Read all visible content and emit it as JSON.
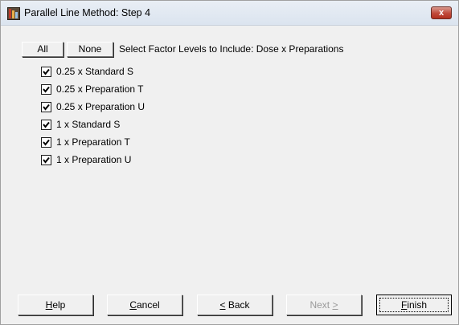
{
  "window": {
    "title": "Parallel Line Method: Step 4",
    "close_label": "x"
  },
  "toolbar": {
    "all_label": "All",
    "none_label": "None",
    "select_label": "Select Factor Levels to Include: Dose x Preparations"
  },
  "levels": [
    {
      "label": "0.25 x Standard S",
      "checked": true
    },
    {
      "label": "0.25 x Preparation T",
      "checked": true
    },
    {
      "label": "0.25 x Preparation U",
      "checked": true
    },
    {
      "label": "1 x Standard S",
      "checked": true
    },
    {
      "label": "1 x Preparation T",
      "checked": true
    },
    {
      "label": "1 x Preparation U",
      "checked": true
    }
  ],
  "buttons": {
    "help": {
      "hotkey": "H",
      "rest": "elp"
    },
    "cancel": {
      "hotkey": "C",
      "rest": "ancel"
    },
    "back": {
      "prefix": "",
      "hotkey": "<",
      "rest": " Back"
    },
    "next": {
      "label": "Next",
      "hotkey": ">"
    },
    "finish": {
      "hotkey": "F",
      "rest": "inish"
    }
  }
}
